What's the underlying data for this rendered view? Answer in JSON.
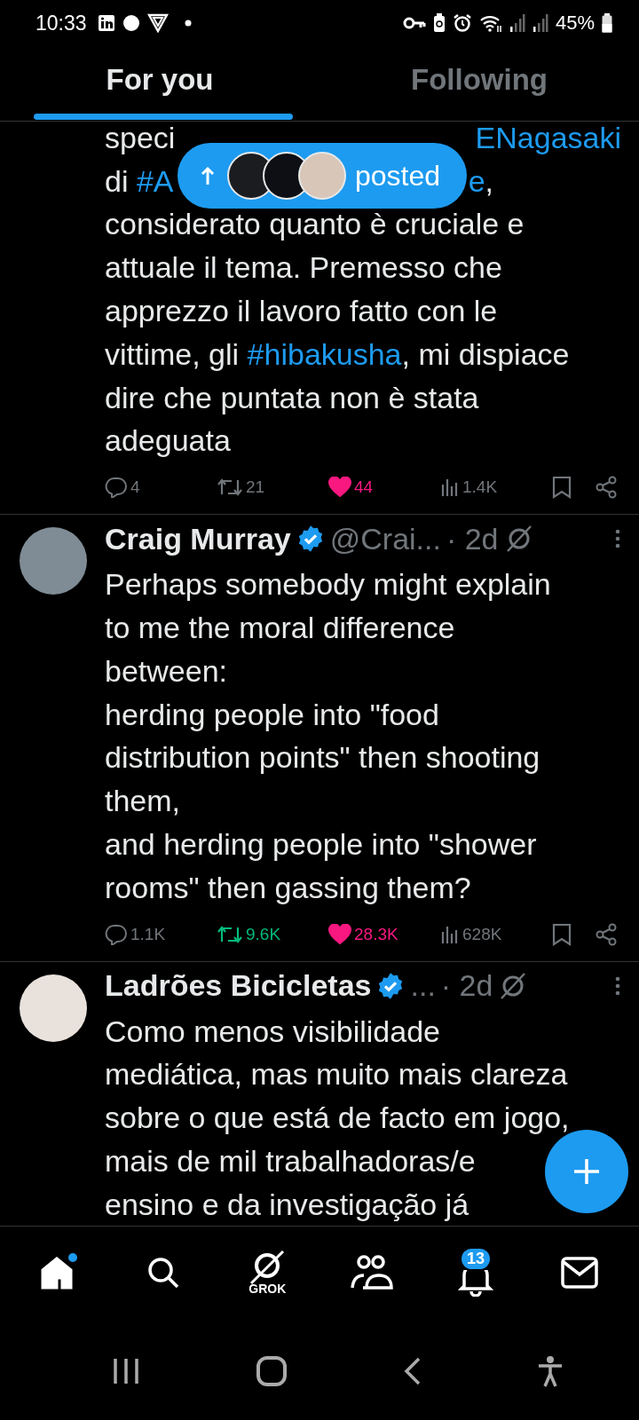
{
  "status_bar": {
    "time": "10:33",
    "battery": "45%"
  },
  "tabs": [
    {
      "label": "For you",
      "selected": true
    },
    {
      "label": "Following",
      "selected": false
    }
  ],
  "new_posts_pill": {
    "label": "posted"
  },
  "posts": [
    {
      "lines": [
        [
          {
            "text": "speci"
          },
          {
            "text": "ENagasaki",
            "kind": "hashtag",
            "after_gap": true
          }
        ],
        [
          {
            "text": "di "
          },
          {
            "text": "#A",
            "kind": "hashtag"
          },
          {
            "text": "e",
            "kind": "hashtag",
            "after_gap": true
          },
          {
            "text": ","
          }
        ],
        [
          {
            "text": "considerato quanto è cruciale e"
          }
        ],
        [
          {
            "text": "attuale il tema. Premesso che"
          }
        ],
        [
          {
            "text": "apprezzo il lavoro fatto con le"
          }
        ],
        [
          {
            "text": "vittime, gli "
          },
          {
            "text": "#hibakusha",
            "kind": "hashtag"
          },
          {
            "text": ", mi dispiace"
          }
        ],
        [
          {
            "text": "dire che puntata non è stata"
          }
        ],
        [
          {
            "text": "adeguata"
          }
        ]
      ],
      "replies": "4",
      "reposts": "21",
      "reposted": false,
      "likes": "44",
      "liked": true,
      "views": "1.4K"
    },
    {
      "author": {
        "name": "Craig Murray",
        "handle": "@Crai...",
        "time": "· 2d",
        "verified": true
      },
      "lines": [
        [
          {
            "text": "Perhaps somebody might explain"
          }
        ],
        [
          {
            "text": "to me the moral difference"
          }
        ],
        [
          {
            "text": "between:"
          }
        ],
        [
          {
            "text": "herding people into \"food"
          }
        ],
        [
          {
            "text": "distribution points\" then shooting"
          }
        ],
        [
          {
            "text": "them,"
          }
        ],
        [
          {
            "text": "and herding people into \"shower"
          }
        ],
        [
          {
            "text": "rooms\" then gassing them?"
          }
        ]
      ],
      "replies": "1.1K",
      "reposts": "9.6K",
      "reposted": true,
      "likes": "28.3K",
      "liked": true,
      "views": "628K"
    },
    {
      "author": {
        "name": "Ladrões Bicicletas",
        "handle": "...",
        "time": "· 2d",
        "verified": true
      },
      "lines": [
        [
          {
            "text": "Como menos visibilidade"
          }
        ],
        [
          {
            "text": "mediática, mas muito mais clareza"
          }
        ],
        [
          {
            "text": "sobre o que está de facto em jogo,"
          }
        ],
        [
          {
            "text": "mais de mil trabalhadoras/e"
          }
        ],
        [
          {
            "text": "ensino e da investigação já"
          }
        ]
      ]
    }
  ],
  "nav": [
    {
      "kind": "home",
      "selected": true,
      "dot": true
    },
    {
      "kind": "search",
      "selected": false
    },
    {
      "kind": "grok",
      "selected": false,
      "label": "GROK"
    },
    {
      "kind": "communities",
      "selected": false
    },
    {
      "kind": "notifications",
      "selected": false,
      "badge": "13"
    },
    {
      "kind": "messages",
      "selected": false
    }
  ]
}
